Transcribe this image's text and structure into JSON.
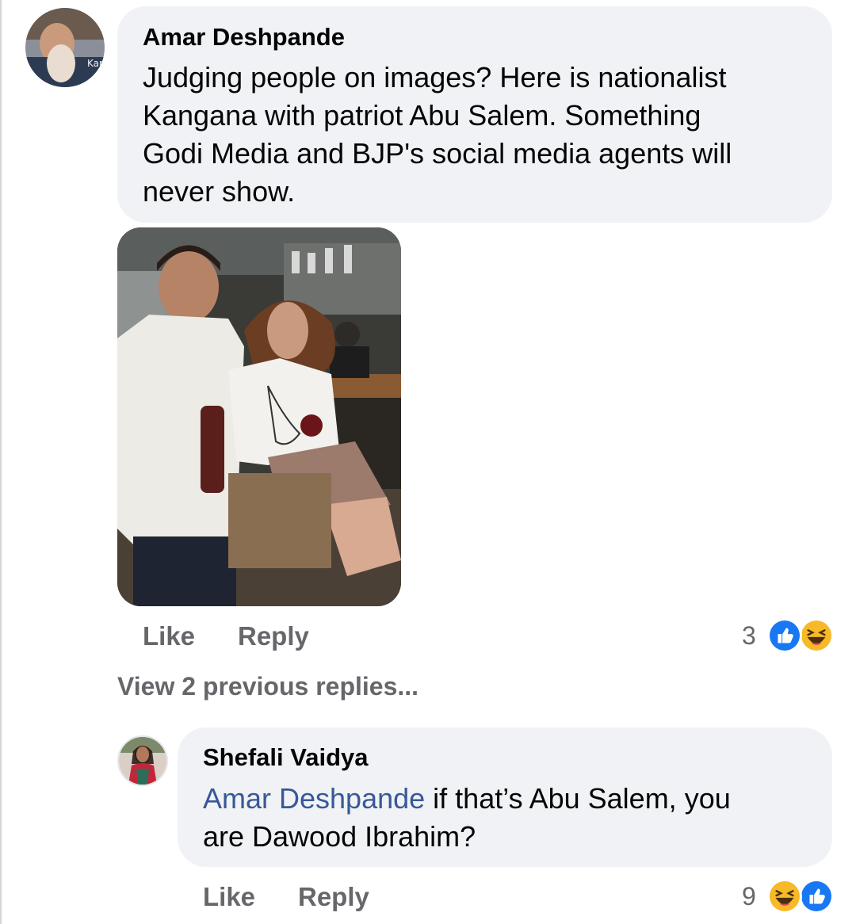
{
  "comment": {
    "author": "Amar Deshpande",
    "text_lines": [
      "Judging people on images? Here is nationalist",
      "Kangana with patriot Abu Salem. Something",
      "Godi Media and BJP's social media agents will",
      "never show."
    ],
    "avatar_text": "Kari",
    "like_label": "Like",
    "reply_label": "Reply",
    "reaction_count": "3",
    "reactions": [
      "like-icon",
      "haha-icon"
    ]
  },
  "view_previous_replies": "View 2 previous replies...",
  "reply": {
    "author": "Shefali Vaidya",
    "mention": "Amar Deshpande",
    "text_after_mention": " if that’s Abu Salem, you",
    "text_line2": "are Dawood Ibrahim?",
    "like_label": "Like",
    "reply_label": "Reply",
    "reaction_count": "9",
    "reactions": [
      "haha-icon",
      "like-icon"
    ]
  },
  "colors": {
    "bubble": "#f0f2f5",
    "secondary_text": "#65676b",
    "mention": "#385898",
    "like_blue": "#1877f2",
    "haha_yellow": "#f7b928"
  }
}
